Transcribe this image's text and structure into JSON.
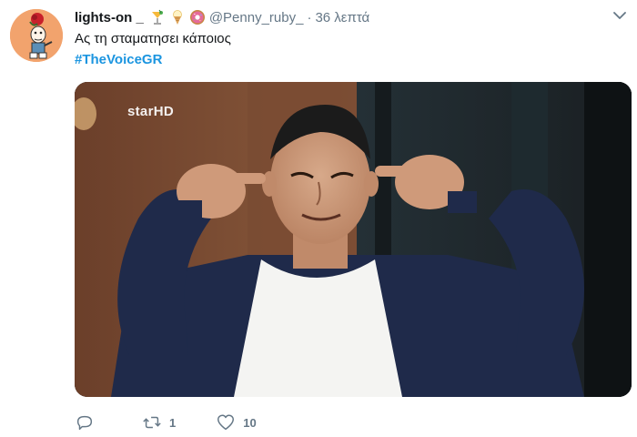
{
  "tweet": {
    "display_name": "lights-on _",
    "handle": "@Penny_ruby_",
    "separator": "·",
    "time": "36 λεπτά",
    "text": "Ας τη σταματησει κάποιος",
    "hashtag": "#TheVoiceGR",
    "emojis": [
      "cocktail-icon",
      "ice-cream-icon",
      "donut-icon"
    ],
    "media": {
      "logo": "starHD",
      "logo_icon": "starhd-logo"
    },
    "actions": {
      "reply_count": "",
      "retweet_count": "1",
      "like_count": "10"
    }
  },
  "colors": {
    "link": "#1b95e0",
    "muted": "#657786",
    "text": "#14171a"
  }
}
